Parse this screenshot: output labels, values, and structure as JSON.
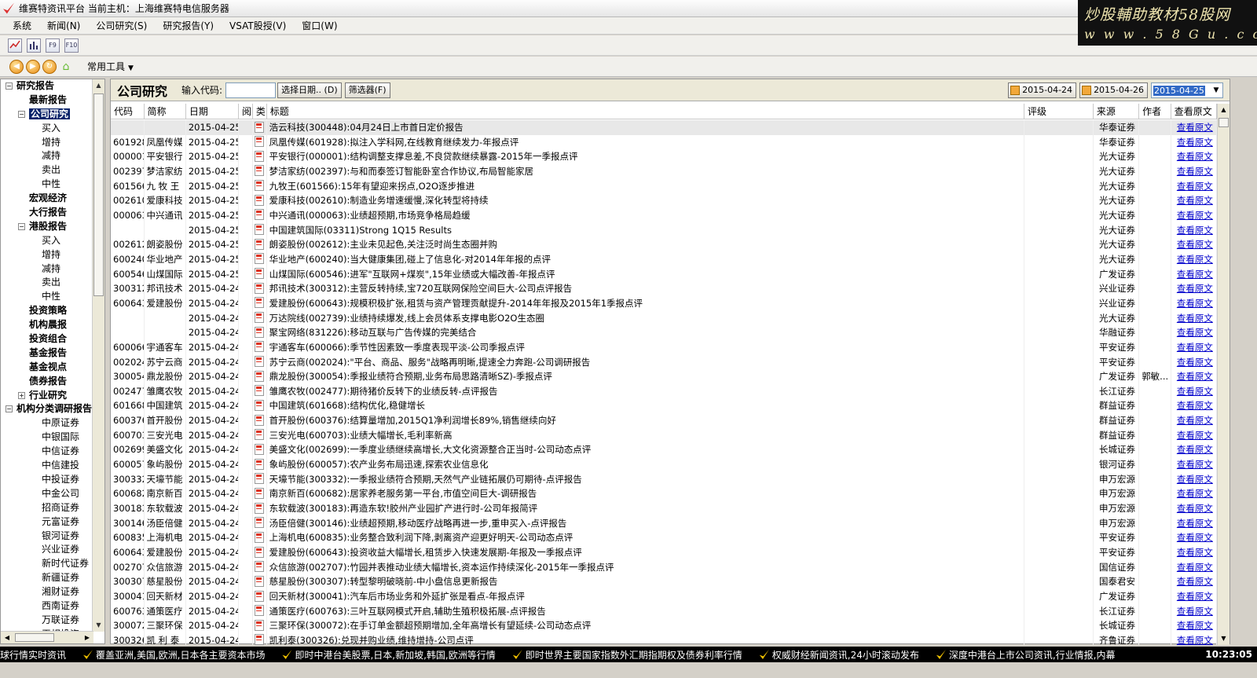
{
  "window": {
    "title": "维赛特资讯平台  当前主机：上海维赛特电信服务器"
  },
  "watermark": {
    "line1": "炒股輔助教材58股网",
    "line2": "w w w . 5 8 G u . c o m"
  },
  "menu": [
    "系统",
    "新闻(N)",
    "公司研究(S)",
    "研究报告(Y)",
    "VSAT股授(V)",
    "窗口(W)"
  ],
  "toolbar1": {
    "icons": [
      "line-chart-icon",
      "bar-chart-icon",
      "f9-icon",
      "f10-icon"
    ],
    "labels": [
      "",
      "",
      "F9",
      "F10"
    ]
  },
  "toolbar2": {
    "tools_label": "常用工具"
  },
  "tree": {
    "nodes": [
      {
        "label": "研究报告",
        "level": 0,
        "exp": "−"
      },
      {
        "label": "最新报告",
        "level": 1
      },
      {
        "label": "公司研究",
        "level": 1,
        "exp": "−",
        "selected": true
      },
      {
        "label": "买入",
        "level": 2
      },
      {
        "label": "增持",
        "level": 2
      },
      {
        "label": "减持",
        "level": 2
      },
      {
        "label": "卖出",
        "level": 2
      },
      {
        "label": "中性",
        "level": 2
      },
      {
        "label": "宏观经济",
        "level": 1
      },
      {
        "label": "大行报告",
        "level": 1
      },
      {
        "label": "港股报告",
        "level": 1,
        "exp": "−"
      },
      {
        "label": "买入",
        "level": 2
      },
      {
        "label": "增持",
        "level": 2
      },
      {
        "label": "减持",
        "level": 2
      },
      {
        "label": "卖出",
        "level": 2
      },
      {
        "label": "中性",
        "level": 2
      },
      {
        "label": "投资策略",
        "level": 1
      },
      {
        "label": "机构晨报",
        "level": 1
      },
      {
        "label": "投资组合",
        "level": 1
      },
      {
        "label": "基金报告",
        "level": 1
      },
      {
        "label": "基金视点",
        "level": 1
      },
      {
        "label": "债券报告",
        "level": 1
      },
      {
        "label": "行业研究",
        "level": 1,
        "exp": "+"
      },
      {
        "label": "机构分类调研报告",
        "level": 0,
        "exp": "−"
      },
      {
        "label": "中原证券",
        "level": 2
      },
      {
        "label": "中银国际",
        "level": 2
      },
      {
        "label": "中信证券",
        "level": 2
      },
      {
        "label": "中信建投",
        "level": 2
      },
      {
        "label": "中投证券",
        "level": 2
      },
      {
        "label": "中金公司",
        "level": 2
      },
      {
        "label": "招商证券",
        "level": 2
      },
      {
        "label": "元富证券",
        "level": 2
      },
      {
        "label": "银河证券",
        "level": 2
      },
      {
        "label": "兴业证券",
        "level": 2
      },
      {
        "label": "新时代证券",
        "level": 2
      },
      {
        "label": "新疆证券",
        "level": 2
      },
      {
        "label": "湘财证券",
        "level": 2
      },
      {
        "label": "西南证券",
        "level": 2
      },
      {
        "label": "万联证券",
        "level": 2
      },
      {
        "label": "天相投资",
        "level": 2
      }
    ]
  },
  "panel": {
    "title": "公司研究",
    "code_label": "输入代码:",
    "code_value": "",
    "select_date_btn": "选择日期.. (D)",
    "filter_btn": "筛选器(F)",
    "date1": "2015-04-24",
    "date2": "2015-04-26",
    "date_select": "2015-04-25"
  },
  "columns": [
    "代码",
    "简称",
    "日期",
    "阅",
    "类",
    "标题",
    "评级",
    "来源",
    "作者",
    "查看原文"
  ],
  "rows": [
    {
      "code": "",
      "name": "",
      "date": "2015-04-25",
      "title": "浩云科技(300448):04月24日上市首日定价报告",
      "rating": "",
      "source": "华泰证券",
      "author": "",
      "link": "查看原文"
    },
    {
      "code": "601928",
      "name": "凤凰传媒",
      "date": "2015-04-25",
      "title": "凤凰传媒(601928):拟注入学科网,在线教育继续发力-年报点评",
      "rating": "",
      "source": "华泰证券",
      "author": "",
      "link": "查看原文"
    },
    {
      "code": "000001",
      "name": "平安银行",
      "date": "2015-04-25",
      "title": "平安银行(000001):结构调整支撑息差,不良贷款继续暴露-2015年一季报点评",
      "rating": "",
      "source": "光大证券",
      "author": "",
      "link": "查看原文"
    },
    {
      "code": "002397",
      "name": "梦洁家纺",
      "date": "2015-04-25",
      "title": "梦洁家纺(002397):与和而泰签订智能卧室合作协议,布局智能家居",
      "rating": "",
      "source": "光大证券",
      "author": "",
      "link": "查看原文"
    },
    {
      "code": "601566",
      "name": "九 牧 王",
      "date": "2015-04-25",
      "title": "九牧王(601566):15年有望迎来拐点,O2O逐步推进",
      "rating": "",
      "source": "光大证券",
      "author": "",
      "link": "查看原文"
    },
    {
      "code": "002610",
      "name": "爱康科技",
      "date": "2015-04-25",
      "title": "爱康科技(002610):制造业务增速缓慢,深化转型将持续",
      "rating": "",
      "source": "光大证券",
      "author": "",
      "link": "查看原文"
    },
    {
      "code": "000063",
      "name": "中兴通讯",
      "date": "2015-04-25",
      "title": "中兴通讯(000063):业绩超预期,市场竞争格局趋缓",
      "rating": "",
      "source": "光大证券",
      "author": "",
      "link": "查看原文"
    },
    {
      "code": "",
      "name": "",
      "date": "2015-04-25",
      "title": "中国建筑国际(03311)Strong 1Q15 Results",
      "rating": "",
      "source": "光大证券",
      "author": "",
      "link": "查看原文"
    },
    {
      "code": "002612",
      "name": "朗姿股份",
      "date": "2015-04-25",
      "title": "朗姿股份(002612):主业未见起色,关注泛时尚生态圈并购",
      "rating": "",
      "source": "光大证券",
      "author": "",
      "link": "查看原文"
    },
    {
      "code": "600240",
      "name": "华业地产",
      "date": "2015-04-25",
      "title": "华业地产(600240):当大健康集团,碰上了信息化-对2014年年报的点评",
      "rating": "",
      "source": "光大证券",
      "author": "",
      "link": "查看原文"
    },
    {
      "code": "600546",
      "name": "山煤国际",
      "date": "2015-04-25",
      "title": "山煤国际(600546):进军\"互联网+煤炭\",15年业绩或大幅改善-年报点评",
      "rating": "",
      "source": "广发证券",
      "author": "",
      "link": "查看原文"
    },
    {
      "code": "300312",
      "name": "邦讯技术",
      "date": "2015-04-24",
      "title": "邦讯技术(300312):主营反转持续,宝720互联网保险空间巨大-公司点评报告",
      "rating": "",
      "source": "兴业证券",
      "author": "",
      "link": "查看原文"
    },
    {
      "code": "600643",
      "name": "爱建股份",
      "date": "2015-04-24",
      "title": "爱建股份(600643):规模积极扩张,租赁与资产管理贡献提升-2014年年报及2015年1季报点评",
      "rating": "",
      "source": "兴业证券",
      "author": "",
      "link": "查看原文"
    },
    {
      "code": "",
      "name": "",
      "date": "2015-04-24",
      "title": "万达院线(002739):业绩持续爆发,线上会员体系支撑电影O2O生态圈",
      "rating": "",
      "source": "光大证券",
      "author": "",
      "link": "查看原文"
    },
    {
      "code": "",
      "name": "",
      "date": "2015-04-24",
      "title": "聚宝网络(831226):移动互联与广告传媒的完美结合",
      "rating": "",
      "source": "华融证券",
      "author": "",
      "link": "查看原文"
    },
    {
      "code": "600066",
      "name": "宇通客车",
      "date": "2015-04-24",
      "title": "宇通客车(600066):季节性因素致一季度表现平淡-公司季报点评",
      "rating": "",
      "source": "平安证券",
      "author": "",
      "link": "查看原文"
    },
    {
      "code": "002024",
      "name": "苏宁云商",
      "date": "2015-04-24",
      "title": "苏宁云商(002024):\"平台、商品、服务\"战略再明晰,提速全力奔跑-公司调研报告",
      "rating": "",
      "source": "平安证券",
      "author": "",
      "link": "查看原文"
    },
    {
      "code": "300054",
      "name": "鼎龙股份",
      "date": "2015-04-24",
      "title": "鼎龙股份(300054):季报业绩符合预期,业务布局思路清晰SZ)-季报点评",
      "rating": "",
      "source": "广发证券",
      "author": "郭敏...",
      "link": "查看原文"
    },
    {
      "code": "002477",
      "name": "雏鹰农牧",
      "date": "2015-04-24",
      "title": "雏鹰农牧(002477):期待猪价反转下的业绩反转-点评报告",
      "rating": "",
      "source": "长江证券",
      "author": "",
      "link": "查看原文"
    },
    {
      "code": "601668",
      "name": "中国建筑",
      "date": "2015-04-24",
      "title": "中国建筑(601668):结构优化,稳健增长",
      "rating": "",
      "source": "群益证券",
      "author": "",
      "link": "查看原文"
    },
    {
      "code": "600376",
      "name": "首开股份",
      "date": "2015-04-24",
      "title": "首开股份(600376):结算量增加,2015Q1净利润增长89%,销售继续向好",
      "rating": "",
      "source": "群益证券",
      "author": "",
      "link": "查看原文"
    },
    {
      "code": "600703",
      "name": "三安光电",
      "date": "2015-04-24",
      "title": "三安光电(600703):业绩大幅增长,毛利率新高",
      "rating": "",
      "source": "群益证券",
      "author": "",
      "link": "查看原文"
    },
    {
      "code": "002699",
      "name": "美盛文化",
      "date": "2015-04-24",
      "title": "美盛文化(002699):一季度业绩继续高增长,大文化资源整合正当时-公司动态点评",
      "rating": "",
      "source": "长城证券",
      "author": "",
      "link": "查看原文"
    },
    {
      "code": "600057",
      "name": "象屿股份",
      "date": "2015-04-24",
      "title": "象屿股份(600057):农产业务布局迅速,探索农业信息化",
      "rating": "",
      "source": "银河证券",
      "author": "",
      "link": "查看原文"
    },
    {
      "code": "300332",
      "name": "天壕节能",
      "date": "2015-04-24",
      "title": "天壕节能(300332):一季报业绩符合预期,天然气产业链拓展仍可期待-点评报告",
      "rating": "",
      "source": "申万宏源",
      "author": "",
      "link": "查看原文"
    },
    {
      "code": "600682",
      "name": "南京新百",
      "date": "2015-04-24",
      "title": "南京新百(600682):居家养老服务第一平台,市值空间巨大-调研报告",
      "rating": "",
      "source": "申万宏源",
      "author": "",
      "link": "查看原文"
    },
    {
      "code": "300183",
      "name": "东软载波",
      "date": "2015-04-24",
      "title": "东软载波(300183):再造东软!胶州产业园扩产进行时-公司年报简评",
      "rating": "",
      "source": "申万宏源",
      "author": "",
      "link": "查看原文"
    },
    {
      "code": "300146",
      "name": "汤臣倍健",
      "date": "2015-04-24",
      "title": "汤臣倍健(300146):业绩超预期,移动医疗战略再进一步,重申买入-点评报告",
      "rating": "",
      "source": "申万宏源",
      "author": "",
      "link": "查看原文"
    },
    {
      "code": "600835",
      "name": "上海机电",
      "date": "2015-04-24",
      "title": "上海机电(600835):业务整合致利润下降,剥离资产迎更好明天-公司动态点评",
      "rating": "",
      "source": "平安证券",
      "author": "",
      "link": "查看原文"
    },
    {
      "code": "600643",
      "name": "爱建股份",
      "date": "2015-04-24",
      "title": "爱建股份(600643):投资收益大幅增长,租赁步入快速发展期-年报及一季报点评",
      "rating": "",
      "source": "平安证券",
      "author": "",
      "link": "查看原文"
    },
    {
      "code": "002707",
      "name": "众信旅游",
      "date": "2015-04-24",
      "title": "众信旅游(002707):竹园并表推动业绩大幅增长,资本运作持续深化-2015年一季报点评",
      "rating": "",
      "source": "国信证券",
      "author": "",
      "link": "查看原文"
    },
    {
      "code": "300307",
      "name": "慈星股份",
      "date": "2015-04-24",
      "title": "慈星股份(300307):转型黎明破晓前-中小盘信息更新报告",
      "rating": "",
      "source": "国泰君安",
      "author": "",
      "link": "查看原文"
    },
    {
      "code": "300041",
      "name": "回天新材",
      "date": "2015-04-24",
      "title": "回天新材(300041):汽车后市场业务和外延扩张是看点-年报点评",
      "rating": "",
      "source": "广发证券",
      "author": "",
      "link": "查看原文"
    },
    {
      "code": "600763",
      "name": "通策医疗",
      "date": "2015-04-24",
      "title": "通策医疗(600763):三叶互联网模式开启,辅助生殖积极拓展-点评报告",
      "rating": "",
      "source": "长江证券",
      "author": "",
      "link": "查看原文"
    },
    {
      "code": "300072",
      "name": "三聚环保",
      "date": "2015-04-24",
      "title": "三聚环保(300072):在手订单金额超预期增加,全年高增长有望延续-公司动态点评",
      "rating": "",
      "source": "长城证券",
      "author": "",
      "link": "查看原文"
    },
    {
      "code": "300326",
      "name": "凯 利 泰",
      "date": "2015-04-24",
      "title": "凯利泰(300326):兑现并购业绩,维持增持-公司点评",
      "rating": "",
      "source": "齐鲁证券",
      "author": "",
      "link": "查看原文"
    }
  ],
  "ticker": {
    "items": [
      "球行情实时资讯",
      "覆盖亚洲,美国,欧洲,日本各主要资本市场",
      "即时中港台美股票,日本,新加坡,韩国,欧洲等行情",
      "即时世界主要国家指数外汇期指期权及债券利率行情",
      "权威财经新闻资讯,24小时滚动发布",
      "深度中港台上市公司资讯,行业情报,内幕"
    ],
    "clock": "10:23:05"
  }
}
